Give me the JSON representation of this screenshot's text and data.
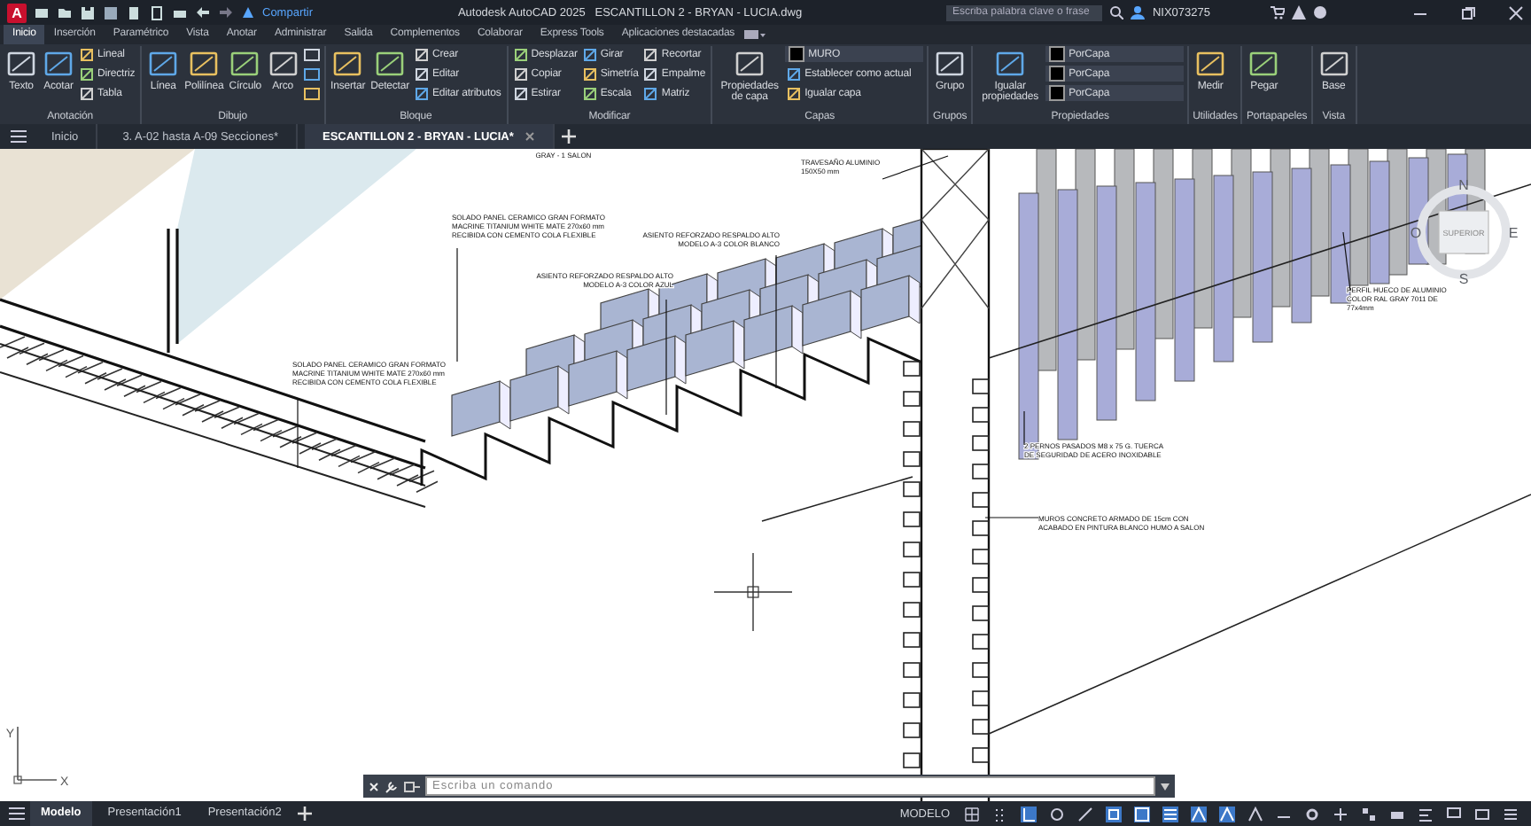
{
  "title_bar": {
    "app_logo": "A",
    "share": "Compartir",
    "title": "Autodesk AutoCAD 2025   ESCANTILLON 2 - BRYAN - LUCIA.dwg",
    "search": {
      "placeholder": "Escriba palabra clave o frase"
    },
    "user": "NIX073275"
  },
  "ribbon_tabs": [
    {
      "label": "Inicio",
      "selected": true
    },
    {
      "label": "Inserción",
      "selected": false
    },
    {
      "label": "Paramétrico",
      "selected": false
    },
    {
      "label": "Vista",
      "selected": false
    },
    {
      "label": "Anotar",
      "selected": false
    },
    {
      "label": "Administrar",
      "selected": false
    },
    {
      "label": "Salida",
      "selected": false
    },
    {
      "label": "Complementos",
      "selected": false
    },
    {
      "label": "Colaborar",
      "selected": false
    },
    {
      "label": "Express Tools",
      "selected": false
    },
    {
      "label": "Aplicaciones destacadas",
      "selected": false
    }
  ],
  "ribbon_panels": [
    {
      "title": "Anotación",
      "tools": [
        {
          "kind": "large",
          "label": "Texto"
        },
        {
          "kind": "large",
          "label": "Acotar"
        },
        {
          "kind": "small",
          "label": "Lineal"
        },
        {
          "kind": "small",
          "label": "Directriz"
        },
        {
          "kind": "small",
          "label": "Tabla"
        }
      ]
    },
    {
      "title": "Dibujo",
      "tools": [
        {
          "kind": "large",
          "label": "Línea"
        },
        {
          "kind": "large",
          "label": "Polilínea"
        },
        {
          "kind": "large",
          "label": "Círculo"
        },
        {
          "kind": "large",
          "label": "Arco"
        },
        {
          "kind": "icon"
        },
        {
          "kind": "icon"
        },
        {
          "kind": "icon"
        }
      ]
    },
    {
      "title": "Bloque",
      "tools": [
        {
          "kind": "large",
          "label": "Insertar"
        },
        {
          "kind": "large",
          "label": "Detectar"
        },
        {
          "kind": "small",
          "label": "Crear"
        },
        {
          "kind": "small",
          "label": "Editar"
        },
        {
          "kind": "small",
          "label": "Editar atributos"
        }
      ]
    },
    {
      "title": "Modificar",
      "tools": [
        {
          "kind": "small",
          "label": "Desplazar"
        },
        {
          "kind": "small",
          "label": "Copiar"
        },
        {
          "kind": "small",
          "label": "Estirar"
        },
        {
          "kind": "small",
          "label": "Girar"
        },
        {
          "kind": "small",
          "label": "Simetría"
        },
        {
          "kind": "small",
          "label": "Escala"
        },
        {
          "kind": "small",
          "label": "Recortar"
        },
        {
          "kind": "small",
          "label": "Empalme"
        },
        {
          "kind": "small",
          "label": "Matriz"
        }
      ]
    },
    {
      "title": "Capas",
      "tools": [
        {
          "kind": "large",
          "label": "Propiedades de capa"
        },
        {
          "kind": "dropdown",
          "value": "MURO"
        },
        {
          "kind": "small",
          "label": "Establecer como actual"
        },
        {
          "kind": "small",
          "label": "Igualar capa"
        }
      ]
    },
    {
      "title": "Grupos",
      "tools": [
        {
          "kind": "large",
          "label": "Grupo"
        }
      ]
    },
    {
      "title": "Propiedades",
      "tools": [
        {
          "kind": "large",
          "label": "Igualar propiedades"
        },
        {
          "kind": "dropdown",
          "value": "PorCapa"
        },
        {
          "kind": "dropdown",
          "value": "PorCapa"
        },
        {
          "kind": "dropdown",
          "value": "PorCapa"
        }
      ]
    },
    {
      "title": "Utilidades",
      "tools": [
        {
          "kind": "large",
          "label": "Medir"
        }
      ]
    },
    {
      "title": "Portapapeles",
      "tools": [
        {
          "kind": "large",
          "label": "Pegar"
        }
      ]
    },
    {
      "title": "Vista",
      "tools": [
        {
          "kind": "large",
          "label": "Base"
        }
      ]
    }
  ],
  "file_tabs": [
    {
      "label": "Inicio",
      "selected": false
    },
    {
      "label": "3. A-02 hasta A-09 Secciones*",
      "selected": false
    },
    {
      "label": "ESCANTILLON 2 - BRYAN - LUCIA*",
      "selected": true
    }
  ],
  "drawing": {
    "annotations": [
      {
        "lines": [
          "GRAY - 1 SALON"
        ]
      },
      {
        "lines": [
          "TRAVESAÑO ALUMINIO",
          "150X50 mm"
        ]
      },
      {
        "lines": [
          "SOLADO PANEL CERAMICO GRAN FORMATO",
          "MACRINE TITANIUM WHITE MATE 270x60 mm",
          "RECIBIDA CON CEMENTO COLA FLEXIBLE"
        ]
      },
      {
        "lines": [
          "ASIENTO REFORZADO RESPALDO ALTO",
          "MODELO A-3 COLOR BLANCO"
        ]
      },
      {
        "lines": [
          "ASIENTO REFORZADO RESPALDO ALTO",
          "MODELO A-3 COLOR AZUL"
        ]
      },
      {
        "lines": [
          "SOLADO PANEL CERAMICO GRAN FORMATO",
          "MACRINE TITANIUM WHITE MATE 270x60 mm",
          "RECIBIDA CON CEMENTO COLA FLEXIBLE"
        ]
      },
      {
        "lines": [
          "PERFIL HUECO DE ALUMINIO",
          "COLOR RAL GRAY 7011 DE",
          "77x4mm"
        ]
      },
      {
        "lines": [
          "2 PERNOS PASADOS M8 x 75 G. TUERCA",
          "DE SEGURIDAD DE ACERO INOXIDABLE"
        ]
      },
      {
        "lines": [
          "MUROS CONCRETO ARMADO DE 15cm CON",
          "ACABADO EN PINTURA BLANCO HUMO A SALON"
        ]
      }
    ],
    "viewcube": {
      "north": "N",
      "south": "S",
      "east": "E",
      "west": "O",
      "face": "SUPERIOR"
    },
    "ucs": {
      "x": "X",
      "y": "Y"
    }
  },
  "command_line": {
    "placeholder": "Escriba un comando"
  },
  "layout_tabs": [
    {
      "label": "Modelo",
      "selected": true
    },
    {
      "label": "Presentación1",
      "selected": false
    },
    {
      "label": "Presentación2",
      "selected": false
    }
  ],
  "status_bar": {
    "mode": "MODELO"
  }
}
